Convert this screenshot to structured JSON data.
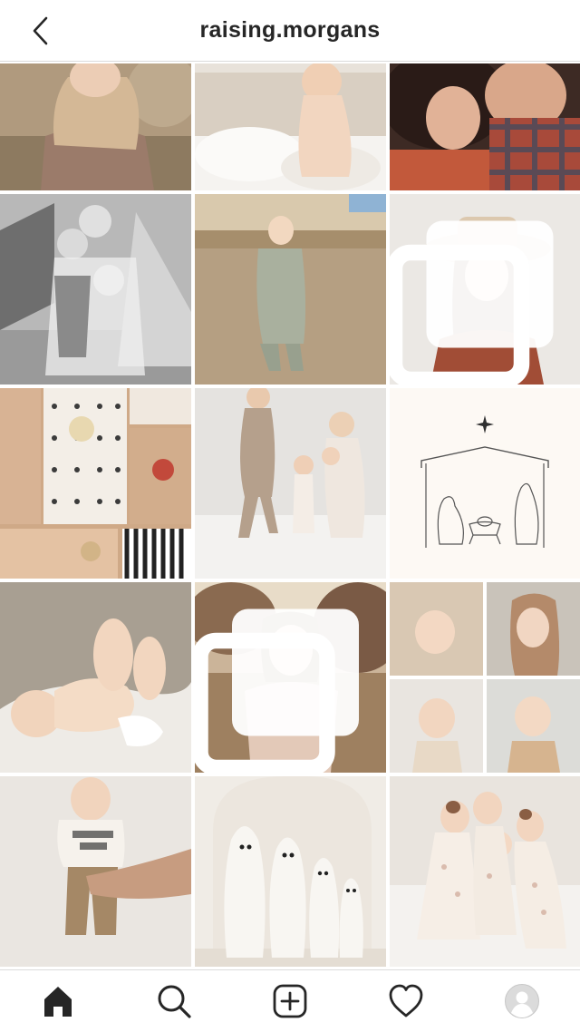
{
  "header": {
    "username": "raising.morgans",
    "back_icon": "chevron-left-icon"
  },
  "grid": {
    "posts": [
      {
        "alt": "girl-in-field",
        "multi": false
      },
      {
        "alt": "baby-on-bed",
        "multi": false
      },
      {
        "alt": "couple-embrace",
        "multi": false
      },
      {
        "alt": "kids-on-slide-bw",
        "multi": false
      },
      {
        "alt": "toddler-looking-up",
        "multi": false
      },
      {
        "alt": "girl-in-hat",
        "multi": true
      },
      {
        "alt": "wrapped-gifts",
        "multi": false
      },
      {
        "alt": "kids-jumping-on-bed",
        "multi": false
      },
      {
        "alt": "nativity-line-art",
        "multi": false
      },
      {
        "alt": "baby-on-blanket",
        "multi": false
      },
      {
        "alt": "girl-in-desert",
        "multi": true
      },
      {
        "alt": "kids-collage",
        "multi": false
      },
      {
        "alt": "birthday-boy",
        "multi": false
      },
      {
        "alt": "ghost-costumes",
        "multi": false
      },
      {
        "alt": "four-kids-pajamas",
        "multi": false
      }
    ]
  },
  "bottom_nav": {
    "items": [
      "home-icon",
      "search-icon",
      "new-post-icon",
      "heart-icon",
      "profile-avatar-icon"
    ],
    "active": "home-icon"
  },
  "colors": {
    "text": "#262626",
    "border": "#dbdbdb",
    "background": "#ffffff"
  }
}
